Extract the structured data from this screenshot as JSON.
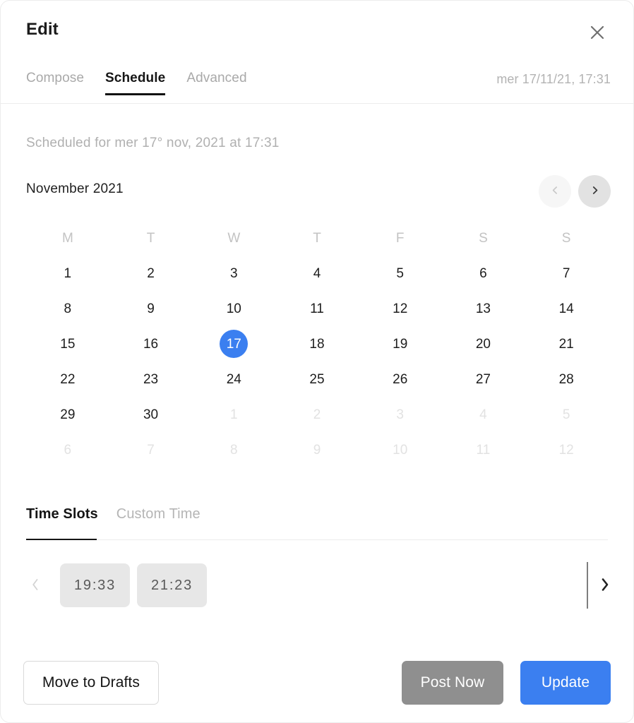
{
  "window": {
    "title": "Edit",
    "close_icon": "close-icon"
  },
  "tabs": {
    "items": [
      {
        "label": "Compose",
        "active": false
      },
      {
        "label": "Schedule",
        "active": true
      },
      {
        "label": "Advanced",
        "active": false
      }
    ],
    "date_label": "mer 17/11/21, 17:31"
  },
  "schedule": {
    "scheduled_text": "Scheduled for mer 17° nov, 2021 at 17:31",
    "calendar": {
      "month_label": "November 2021",
      "prev_icon": "chevron-left-icon",
      "next_icon": "chevron-right-icon",
      "weekdays": [
        "M",
        "T",
        "W",
        "T",
        "F",
        "S",
        "S"
      ],
      "weeks": [
        [
          {
            "day": "1",
            "muted": false,
            "selected": false
          },
          {
            "day": "2",
            "muted": false,
            "selected": false
          },
          {
            "day": "3",
            "muted": false,
            "selected": false
          },
          {
            "day": "4",
            "muted": false,
            "selected": false
          },
          {
            "day": "5",
            "muted": false,
            "selected": false
          },
          {
            "day": "6",
            "muted": false,
            "selected": false
          },
          {
            "day": "7",
            "muted": false,
            "selected": false
          }
        ],
        [
          {
            "day": "8",
            "muted": false,
            "selected": false
          },
          {
            "day": "9",
            "muted": false,
            "selected": false
          },
          {
            "day": "10",
            "muted": false,
            "selected": false
          },
          {
            "day": "11",
            "muted": false,
            "selected": false
          },
          {
            "day": "12",
            "muted": false,
            "selected": false
          },
          {
            "day": "13",
            "muted": false,
            "selected": false
          },
          {
            "day": "14",
            "muted": false,
            "selected": false
          }
        ],
        [
          {
            "day": "15",
            "muted": false,
            "selected": false
          },
          {
            "day": "16",
            "muted": false,
            "selected": false
          },
          {
            "day": "17",
            "muted": false,
            "selected": true
          },
          {
            "day": "18",
            "muted": false,
            "selected": false
          },
          {
            "day": "19",
            "muted": false,
            "selected": false
          },
          {
            "day": "20",
            "muted": false,
            "selected": false
          },
          {
            "day": "21",
            "muted": false,
            "selected": false
          }
        ],
        [
          {
            "day": "22",
            "muted": false,
            "selected": false
          },
          {
            "day": "23",
            "muted": false,
            "selected": false
          },
          {
            "day": "24",
            "muted": false,
            "selected": false
          },
          {
            "day": "25",
            "muted": false,
            "selected": false
          },
          {
            "day": "26",
            "muted": false,
            "selected": false
          },
          {
            "day": "27",
            "muted": false,
            "selected": false
          },
          {
            "day": "28",
            "muted": false,
            "selected": false
          }
        ],
        [
          {
            "day": "29",
            "muted": false,
            "selected": false
          },
          {
            "day": "30",
            "muted": false,
            "selected": false
          },
          {
            "day": "1",
            "muted": true,
            "selected": false
          },
          {
            "day": "2",
            "muted": true,
            "selected": false
          },
          {
            "day": "3",
            "muted": true,
            "selected": false
          },
          {
            "day": "4",
            "muted": true,
            "selected": false
          },
          {
            "day": "5",
            "muted": true,
            "selected": false
          }
        ],
        [
          {
            "day": "6",
            "muted": true,
            "selected": false
          },
          {
            "day": "7",
            "muted": true,
            "selected": false
          },
          {
            "day": "8",
            "muted": true,
            "selected": false
          },
          {
            "day": "9",
            "muted": true,
            "selected": false
          },
          {
            "day": "10",
            "muted": true,
            "selected": false
          },
          {
            "day": "11",
            "muted": true,
            "selected": false
          },
          {
            "day": "12",
            "muted": true,
            "selected": false
          }
        ]
      ]
    },
    "slot_tabs": [
      {
        "label": "Time Slots",
        "active": true
      },
      {
        "label": "Custom Time",
        "active": false
      }
    ],
    "slots": {
      "prev_icon": "chevron-left-icon",
      "next_icon": "chevron-right-icon",
      "times": [
        "19:33",
        "21:23"
      ]
    }
  },
  "footer": {
    "move_to_drafts_label": "Move to Drafts",
    "post_now_label": "Post Now",
    "update_label": "Update"
  },
  "colors": {
    "accent_blue": "#3b7ff0",
    "post_now_gray": "#8f8f8f",
    "muted_text": "#b0b0b0"
  }
}
